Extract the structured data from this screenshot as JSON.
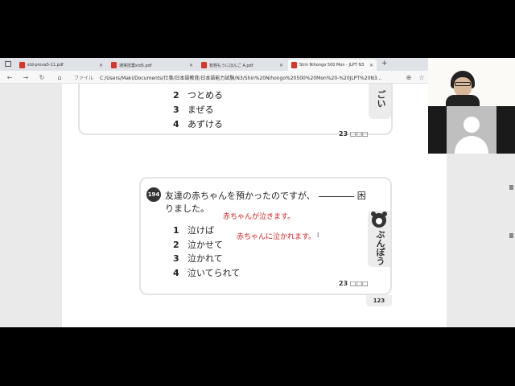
{
  "browser": {
    "tabs": [
      {
        "label": "std-prova5-11.pdf"
      },
      {
        "label": "通常授業std5.pdf"
      },
      {
        "label": "有題もうにほんご A.pdf"
      },
      {
        "label": "Shin Nihongo 500 Mon - JLPT N3"
      }
    ],
    "new_tab": "+",
    "file_label": "ファイル",
    "address": "C:/Users/Maki/Documents/仕事/日本語教育/日本語能力試験/N3/Shin%20Nihongo%20500%20Mon%20-%20JLPT%20N3..."
  },
  "card1": {
    "options": [
      {
        "num": "2",
        "text": "つとめる"
      },
      {
        "num": "3",
        "text": "まぜる"
      },
      {
        "num": "4",
        "text": "あずける"
      }
    ],
    "score": "23 □□□",
    "side_label": "ごい"
  },
  "card2": {
    "question_number": "194",
    "question_line1_a": "友達の赤ちゃんを預かったのですが、",
    "question_line1_b": "困",
    "question_line2": "りました。",
    "annotation1": "赤ちゃんが泣きます。",
    "annotation2": "赤ちゃんに泣かれます。",
    "options": [
      {
        "num": "1",
        "text": "泣けば"
      },
      {
        "num": "2",
        "text": "泣かせて"
      },
      {
        "num": "3",
        "text": "泣かれて"
      },
      {
        "num": "4",
        "text": "泣いてられて"
      }
    ],
    "score": "23 □□□",
    "side_label": "ぶんぽう"
  },
  "page_number": "123"
}
